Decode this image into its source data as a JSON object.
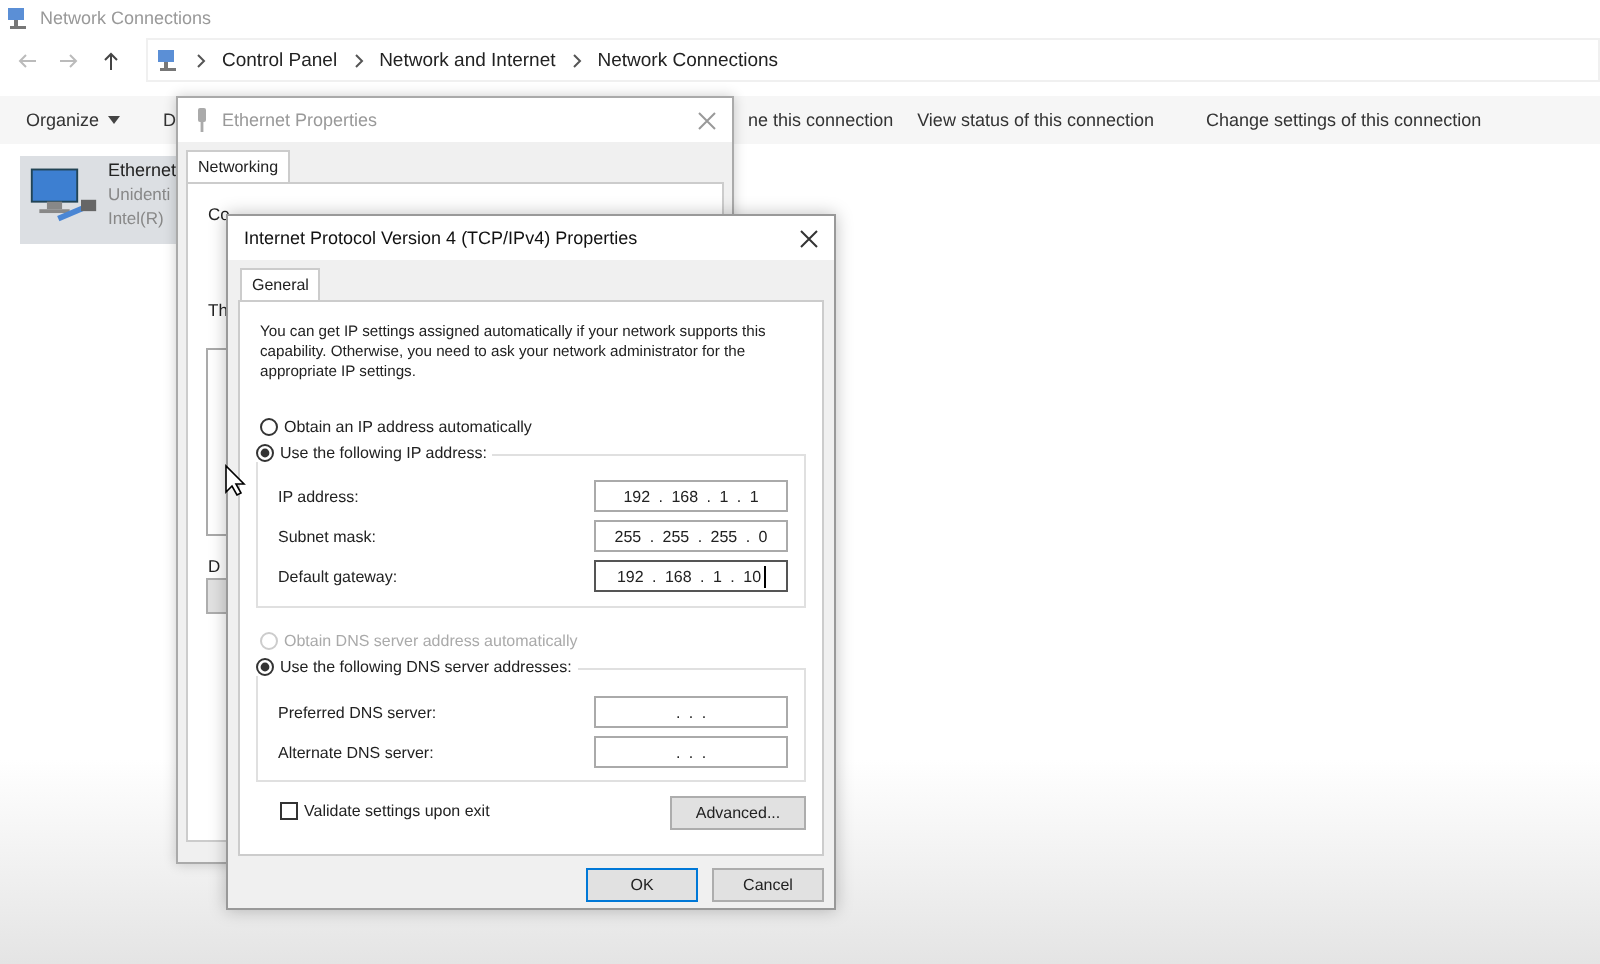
{
  "explorer": {
    "title": "Network Connections",
    "breadcrumb": [
      "Control Panel",
      "Network and Internet",
      "Network Connections"
    ],
    "toolbar": [
      {
        "label": "Organize",
        "kind": "menu"
      },
      {
        "label": "D",
        "kind": "action"
      },
      {
        "label": "ne this connection",
        "kind": "action"
      },
      {
        "label": "View status of this connection",
        "kind": "action"
      },
      {
        "label": "Change settings of this connection",
        "kind": "action"
      }
    ],
    "items": [
      {
        "name": "Ethernet",
        "status": "Unidenti",
        "adapter": "Intel(R)",
        "selected": true
      }
    ]
  },
  "ethernet_properties": {
    "title": "Ethernet Properties",
    "tabs": [
      {
        "label": "Networking",
        "selected": true
      }
    ],
    "texts": [
      "Co",
      "Th",
      "D"
    ]
  },
  "ipv4_properties": {
    "title": "Internet Protocol Version 4 (TCP/IPv4) Properties",
    "tabs": [
      {
        "label": "General",
        "selected": true
      }
    ],
    "description": "You can get IP settings assigned automatically if your network supports this capability. Otherwise, you need to ask your network administrator for the appropriate IP settings.",
    "ip_options": [
      {
        "label": "Obtain an IP address automatically",
        "selected": false,
        "disabled": false
      },
      {
        "label": "Use the following IP address:",
        "selected": true,
        "disabled": false
      }
    ],
    "ip_fields": [
      {
        "label": "IP address:",
        "value": "192 . 168 . 1 . 1",
        "focused": false
      },
      {
        "label": "Subnet mask:",
        "value": "255 . 255 . 255 . 0",
        "focused": false
      },
      {
        "label": "Default gateway:",
        "value": "192 . 168 . 1 . 10",
        "focused": true
      }
    ],
    "dns_options": [
      {
        "label": "Obtain DNS server address automatically",
        "selected": false,
        "disabled": true
      },
      {
        "label": "Use the following DNS server addresses:",
        "selected": true,
        "disabled": false
      }
    ],
    "dns_fields": [
      {
        "label": "Preferred DNS server:",
        "value": ". . .",
        "focused": false
      },
      {
        "label": "Alternate DNS server:",
        "value": ". . .",
        "focused": false
      }
    ],
    "validate": {
      "label": "Validate settings upon exit",
      "checked": false
    },
    "buttons": [
      {
        "label": "Advanced...",
        "kind": "advanced",
        "default": false
      },
      {
        "label": "OK",
        "kind": "dialog",
        "default": true
      },
      {
        "label": "Cancel",
        "kind": "dialog",
        "default": false
      }
    ]
  }
}
